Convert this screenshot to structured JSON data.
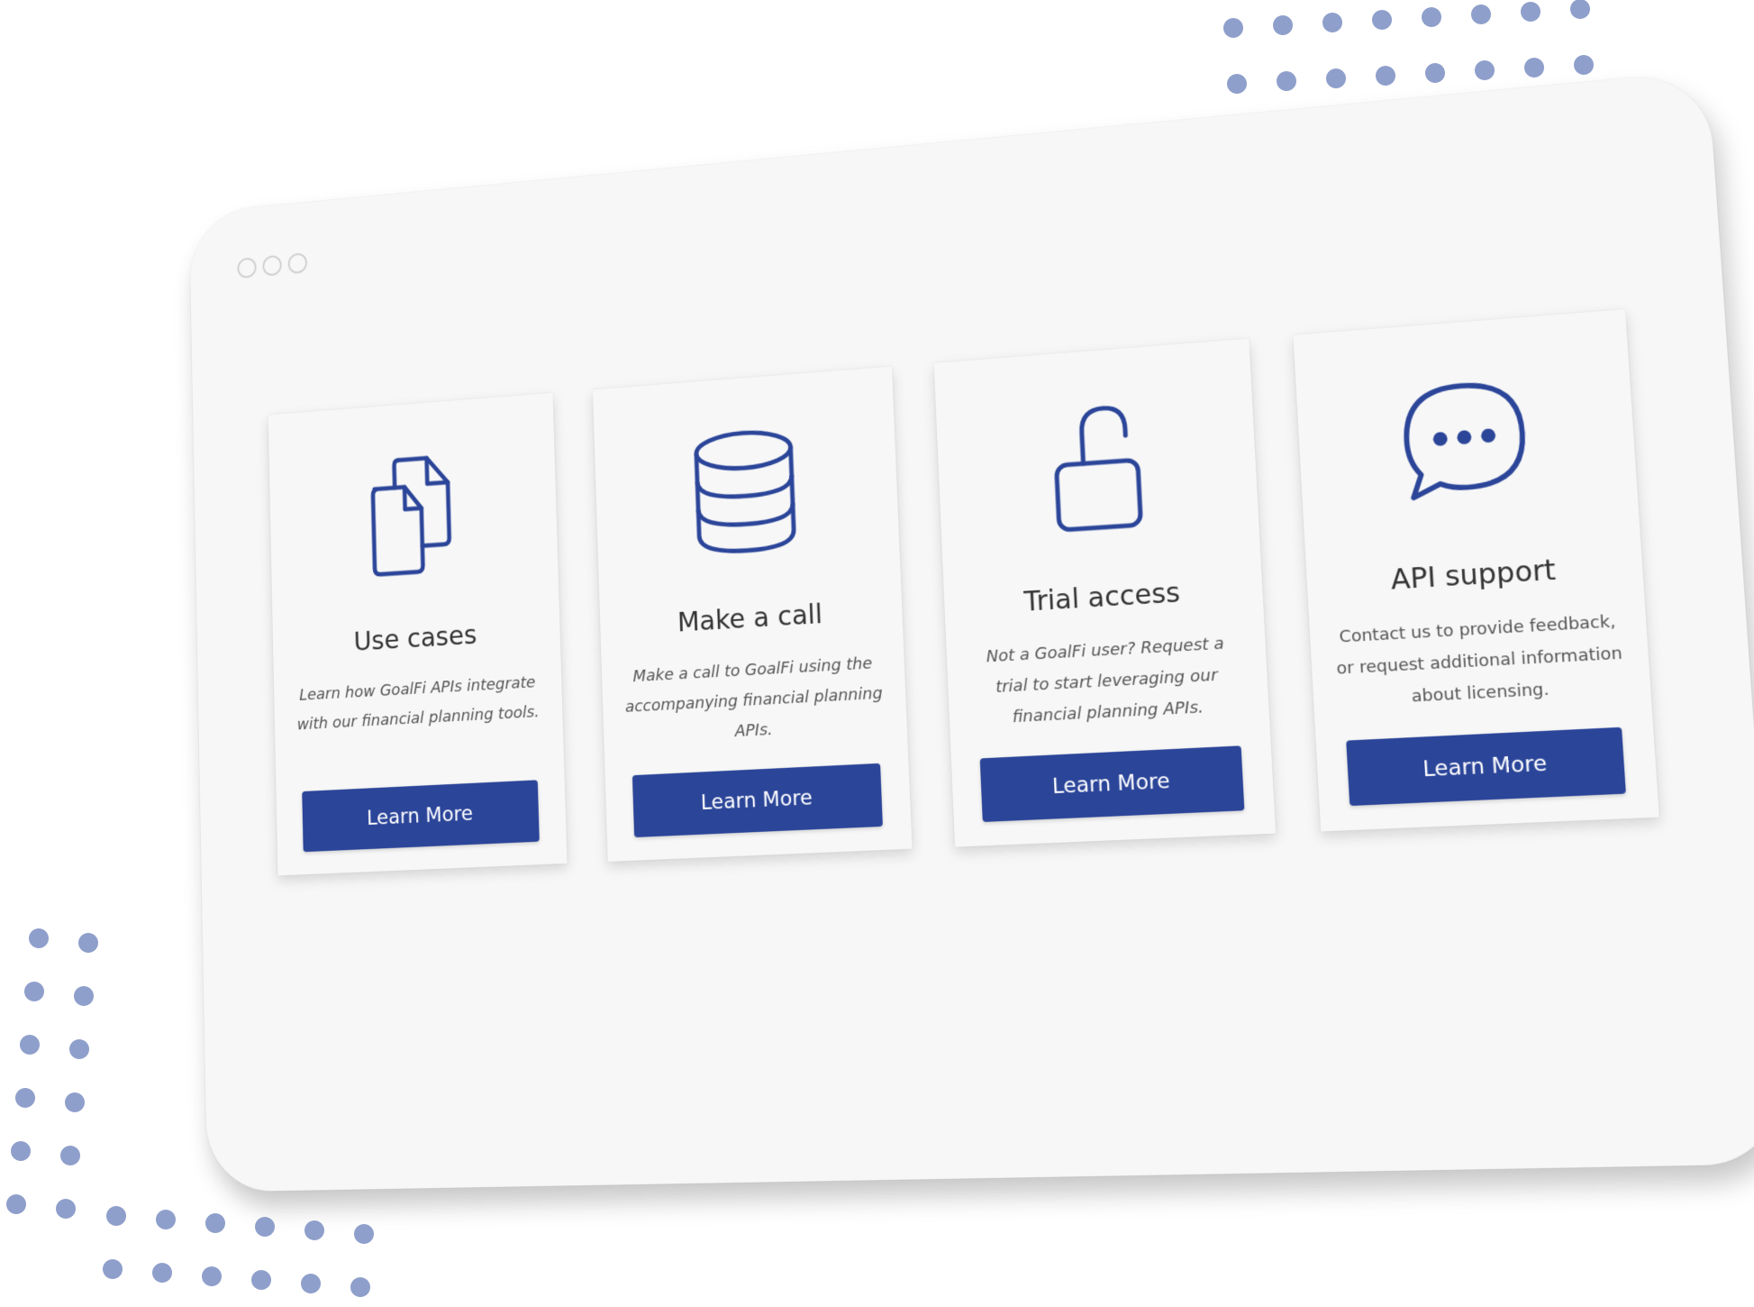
{
  "window": {
    "controls": [
      "window-control-1",
      "window-control-2",
      "window-control-3"
    ]
  },
  "cards": [
    {
      "icon": "documents-icon",
      "title": "Use cases",
      "description": "Learn how GoalFi APIs integrate with our financial planning tools.",
      "button_label": "Learn More"
    },
    {
      "icon": "database-icon",
      "title": "Make a call",
      "description": "Make a call to GoalFi using the accompanying financial planning APIs.",
      "button_label": "Learn More"
    },
    {
      "icon": "unlocked-padlock-icon",
      "title": "Trial access",
      "description": "Not a GoalFi user? Request a trial to start leveraging our financial planning APIs.",
      "button_label": "Learn More"
    },
    {
      "icon": "chat-bubble-icon",
      "title": "API support",
      "description": "Contact us to provide feedback, or request additional information about licensing.",
      "button_label": "Learn More"
    }
  ],
  "colors": {
    "accent": "#2b4599",
    "icon_stroke": "#2b4599",
    "decorative_dots": "#8f9fcb",
    "window_background": "#f7f7f7",
    "title_text": "#333333",
    "body_text": "#555555"
  }
}
